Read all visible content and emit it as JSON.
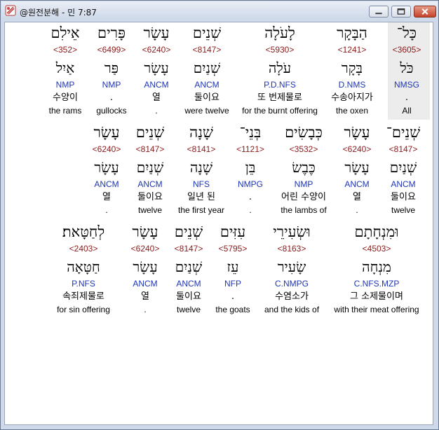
{
  "window": {
    "title": "@원전분해 - 민 7:87"
  },
  "colors": {
    "strongs": "#8b1a1a",
    "morph": "#1f35b5",
    "selected_bg": "#eaeaea"
  },
  "rows": [
    [
      {
        "heb": "כָּל־",
        "num": "<3605>",
        "lex": "כֹּל",
        "morph": "NMSG",
        "kor": ".",
        "eng": "All"
      },
      {
        "heb": "הַבָּקָר",
        "num": "<1241>",
        "lex": "בָּקָר",
        "morph": "D.NMS",
        "kor": "수송아지가",
        "eng": "the oxen"
      },
      {
        "heb": "לָעֹלָה",
        "num": "<5930>",
        "lex": "עֹלָה",
        "morph": "P.D.NFS",
        "kor": "또 번제물로",
        "eng": "for the burnt offering"
      },
      {
        "heb": "שְׁנֵים",
        "num": "<8147>",
        "lex": "שְׁנַיִם",
        "morph": "ANCM",
        "kor": "둘이요",
        "eng": "were twelve"
      },
      {
        "heb": "עָשָׂר",
        "num": "<6240>",
        "lex": "עָשָׂר",
        "morph": "ANCM",
        "kor": "열",
        "eng": "."
      },
      {
        "heb": "פָּרִים",
        "num": "<6499>",
        "lex": "פַּר",
        "morph": "NMP",
        "kor": ".",
        "eng": "gullocks"
      },
      {
        "heb": "אֵילִם",
        "num": "<352>",
        "lex": "אַיִל",
        "morph": "NMP",
        "kor": "수양이",
        "eng": "the rams"
      }
    ],
    [
      {
        "heb": "שְׁנֵים־",
        "num": "<8147>",
        "lex": "שְׁנַיִם",
        "morph": "ANCM",
        "kor": "둘이요",
        "eng": "twelve"
      },
      {
        "heb": "עָשָׂר",
        "num": "<6240>",
        "lex": "עָשָׂר",
        "morph": "ANCM",
        "kor": "열",
        "eng": "."
      },
      {
        "heb": "כְּבָשִׂים",
        "num": "<3532>",
        "lex": "כֶּבֶשׂ",
        "morph": "NMP",
        "kor": "어린 수양이",
        "eng": "the lambs of"
      },
      {
        "heb": "בְּנֵי־",
        "num": "<1121>",
        "lex": "בֵּן",
        "morph": "NMPG",
        "kor": ".",
        "eng": "."
      },
      {
        "heb": "שָׁנָה",
        "num": "<8141>",
        "lex": "שָׁנָה",
        "morph": "NFS",
        "kor": "일년 된",
        "eng": "the first year"
      },
      {
        "heb": "שְׁנֵים",
        "num": "<8147>",
        "lex": "שְׁנַיִם",
        "morph": "ANCM",
        "kor": "둘이요",
        "eng": "twelve"
      },
      {
        "heb": "עָשָׂר",
        "num": "<6240>",
        "lex": "עָשָׂר",
        "morph": "ANCM",
        "kor": "열",
        "eng": "."
      }
    ],
    [
      {
        "heb": "וּמִנְחָתָם",
        "num": "<4503>",
        "lex": "מִנְחָה",
        "morph": "C.NFS.MZP",
        "kor": "그 소제물이며",
        "eng": "with their meat offering"
      },
      {
        "heb": "וּשְׂעִירֵי",
        "num": "<8163>",
        "lex": "שָׂעִיר",
        "morph": "C.NMPG",
        "kor": "수염소가",
        "eng": "and the kids of"
      },
      {
        "heb": "עִזִּים",
        "num": "<5795>",
        "lex": "עֵז",
        "morph": "NFP",
        "kor": ".",
        "eng": "the goats"
      },
      {
        "heb": "שְׁנֵים",
        "num": "<8147>",
        "lex": "שְׁנַיִם",
        "morph": "ANCM",
        "kor": "둘이요",
        "eng": "twelve"
      },
      {
        "heb": "עָשָׂר",
        "num": "<6240>",
        "lex": "עָשָׂר",
        "morph": "ANCM",
        "kor": "열",
        "eng": "."
      },
      {
        "heb": "לְחַטָּאת׃",
        "num": "<2403>",
        "lex": "חַטָּאָה",
        "morph": "P.NFS",
        "kor": "속죄제물로",
        "eng": "for sin offering"
      }
    ]
  ]
}
